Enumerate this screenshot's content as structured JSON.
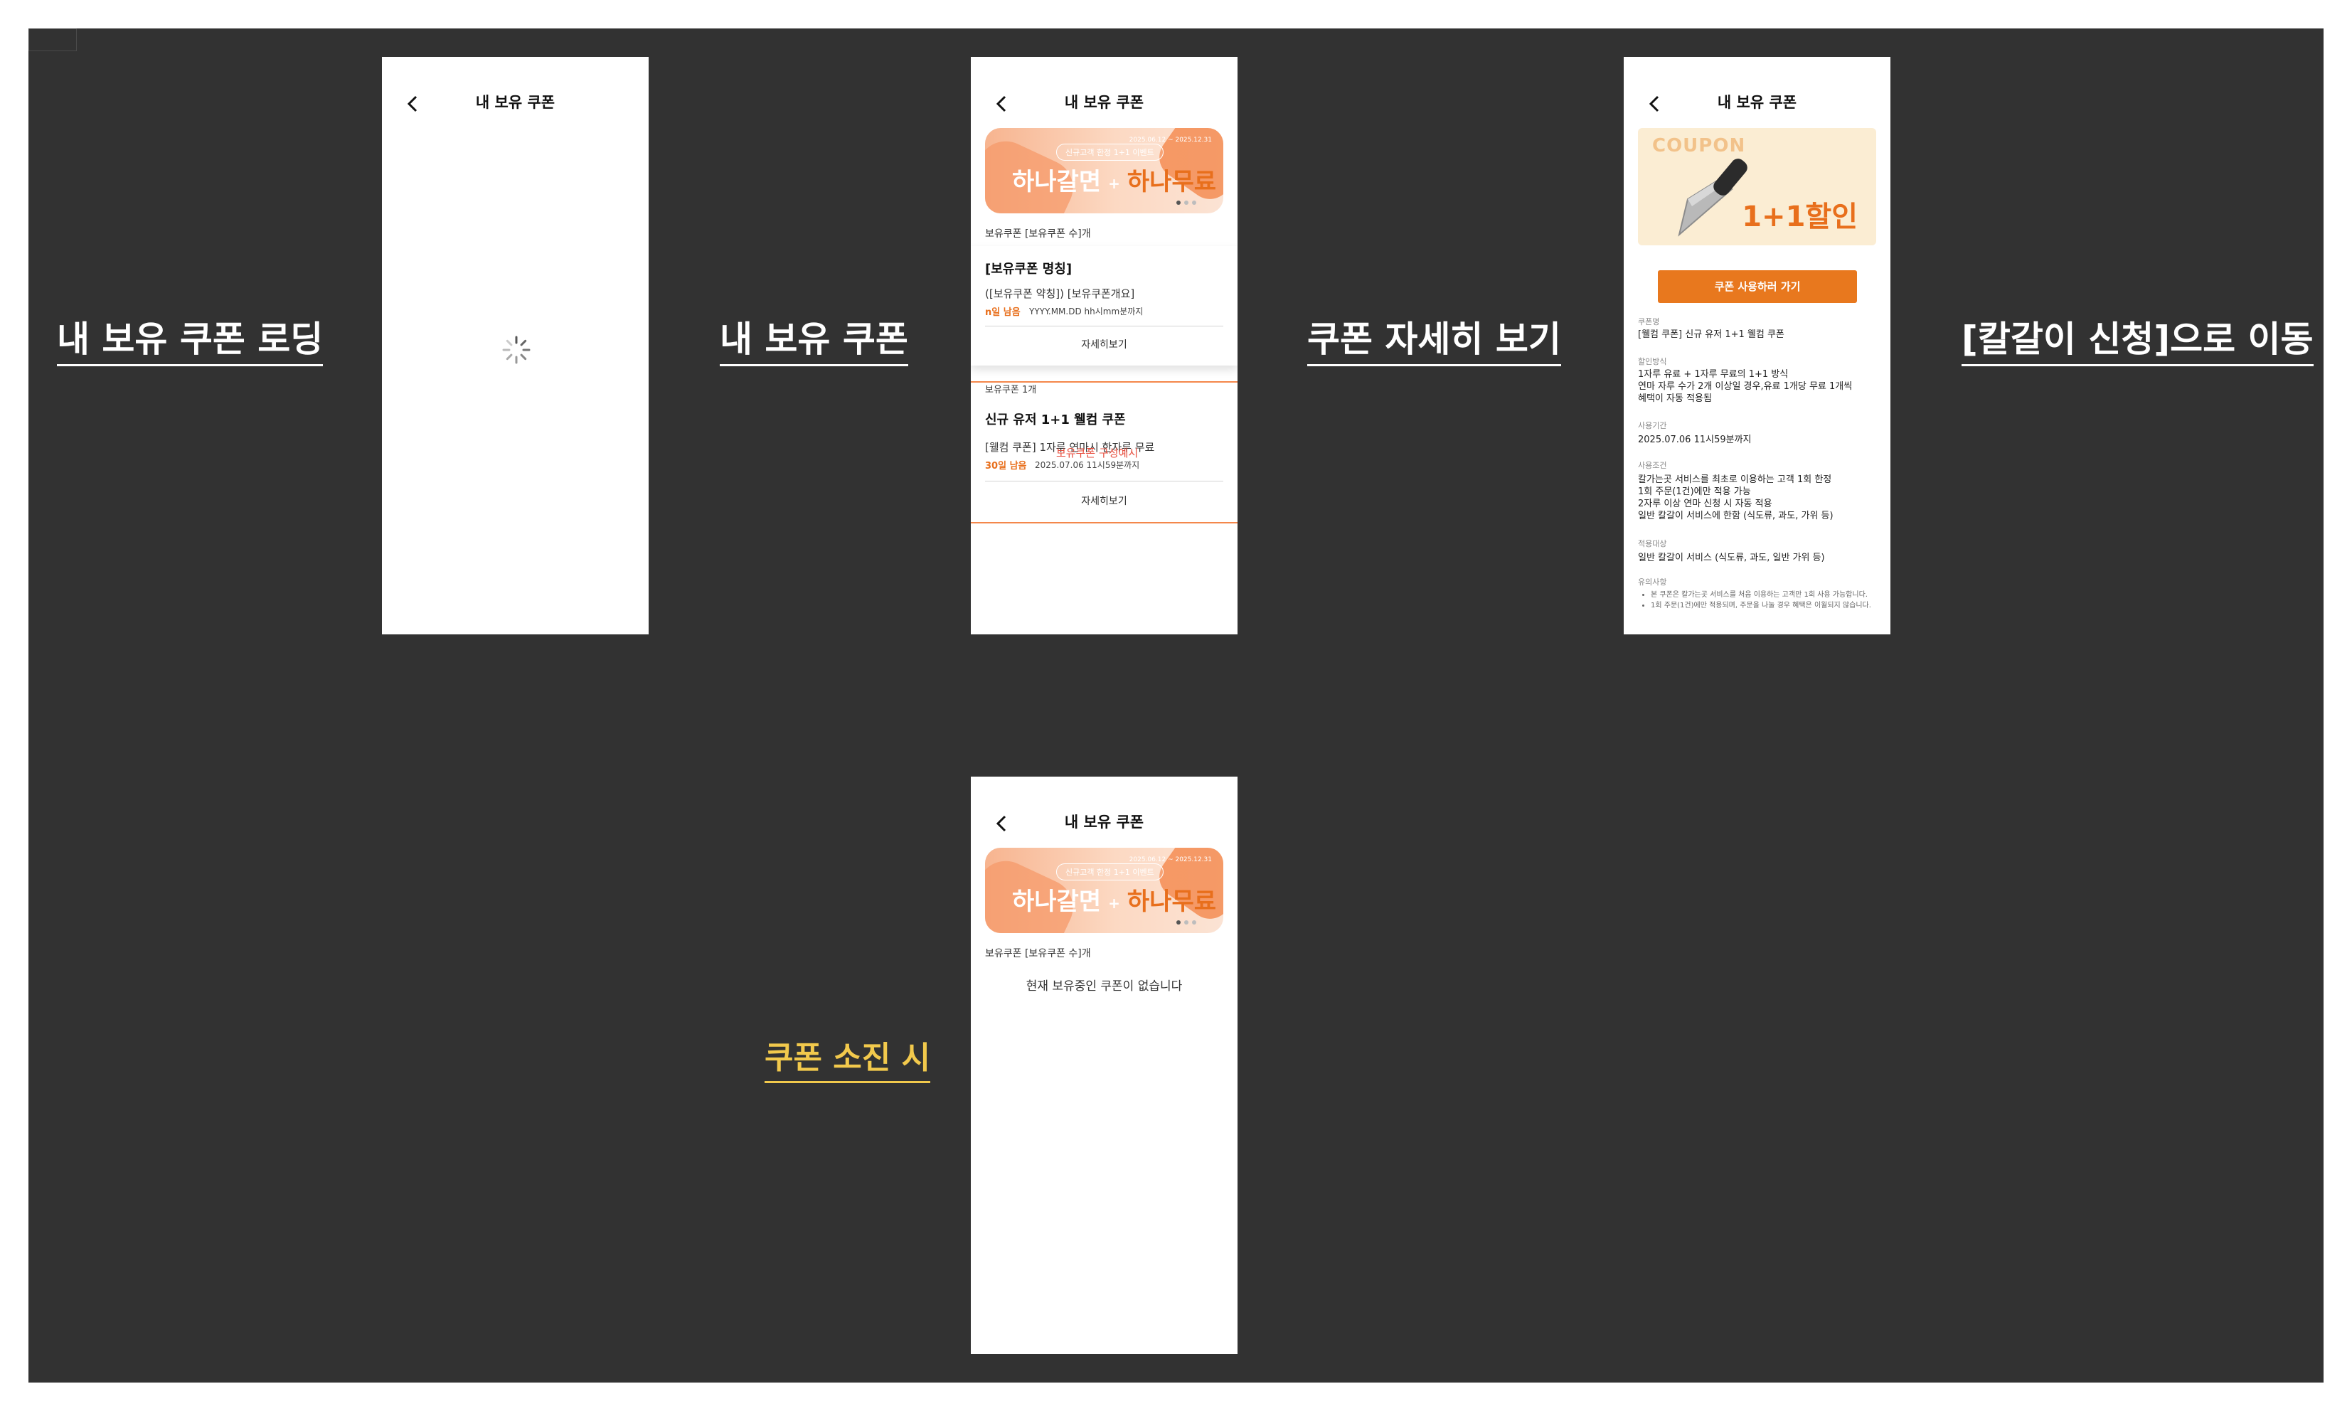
{
  "labels": {
    "loading": "내 보유 쿠폰 로딩",
    "my_coupons": "내 보유 쿠폰",
    "detail": "쿠폰 자세히 보기",
    "navigate": "[칼갈이 신청]으로 이동",
    "exhausted": "쿠폰 소진 시"
  },
  "header": {
    "title": "내 보유 쿠폰"
  },
  "banner": {
    "pill": "신규고객 한정 1+1 이벤트",
    "date": "2025.06.12 ~ 2025.12.31",
    "main_left": "하나갈면",
    "plus": "+",
    "main_right": "하나무료"
  },
  "list": {
    "count_text": "보유쿠폰 [보유쿠폰 수]개",
    "card1": {
      "name": "[보유쿠폰 명칭]",
      "desc": "([보유쿠폰 약칭]) [보유쿠폰개요]",
      "days_left": "n일 남음",
      "expiry": "YYYY.MM.DD hh시mm분까지",
      "detail_button": "자세히보기"
    },
    "count_text2": "보유쿠폰 1개",
    "card2": {
      "name": "신규 유저 1+1 웰컴 쿠폰",
      "desc": "[웰컴 쿠폰] 1자루 연마시 한자루 무료",
      "overlay": "보유쿠폰 구성예시",
      "days_left": "30일 남음",
      "expiry": "2025.07.06 11시59분까지",
      "detail_button": "자세히보기"
    }
  },
  "empty": {
    "count_text": "보유쿠폰 [보유쿠폰 수]개",
    "message": "현재 보유중인 쿠폰이 없습니다"
  },
  "detail": {
    "watermark": "COUPON",
    "discount": "1+1할인",
    "cta": "쿠폰 사용하러 가기",
    "name_label": "쿠폰명",
    "name_value": "[웰컴 쿠폰] 신규 유저 1+1 웰컴 쿠폰",
    "method_label": "할인방식",
    "method_lines": [
      "1자루 유료 + 1자루 무료의 1+1 방식",
      "연마 자루 수가 2개 이상일 경우,유료 1개당 무료 1개씩",
      "혜택이 자동 적용됨"
    ],
    "period_label": "사용기간",
    "period_value": "2025.07.06 11시59분까지",
    "condition_label": "사용조건",
    "condition_lines": [
      "칼가는곳 서비스를 최초로 이용하는 고객 1회 한정",
      "1회 주문(1건)에만 적용 가능",
      "2자루 이상 연마 신청 시 자동 적용",
      "일반 칼갈이 서비스에 한함 (식도류, 과도, 가위 등)"
    ],
    "target_label": "적용대상",
    "target_value": "일반 칼갈이 서비스 (식도류, 과도, 일반 가위 등)",
    "notice_label": "유의사항",
    "notice_items": [
      "본 쿠폰은 칼가는곳 서비스를 처음 이용하는 고객만 1회 사용 가능합니다.",
      "1회 주문(1건)에만 적용되며, 주문을 나눌 경우 혜택은 이월되지 않습니다."
    ]
  },
  "colors": {
    "accent": "#e8781e",
    "board": "#323232",
    "label_yellow": "#f2c94c"
  },
  "icons": {
    "back": "chevron-left-icon",
    "loading": "spinner-icon",
    "knife": "knife-icon"
  }
}
